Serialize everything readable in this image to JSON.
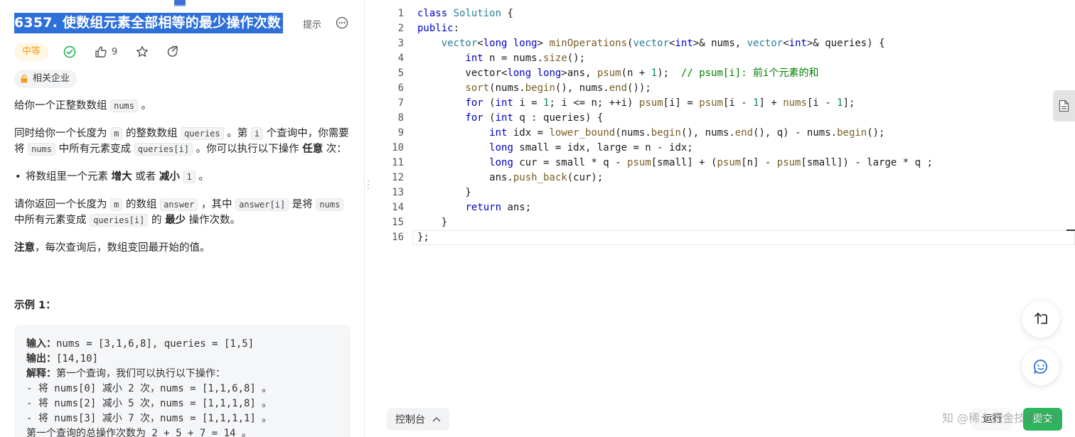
{
  "problem": {
    "title": "6357. 使数组元素全部相等的最少操作次数",
    "hint_label": "提示",
    "difficulty": "中等",
    "likes": "9",
    "company_tag": "相关企业"
  },
  "description": {
    "p1_a": "给你一个正整数数组 ",
    "p1_code": "nums",
    "p1_b": " 。",
    "p2_a": "同时给你一个长度为 ",
    "p2_code1": "m",
    "p2_b": " 的整数数组 ",
    "p2_code2": "queries",
    "p2_c": " 。第 ",
    "p2_code3": "i",
    "p2_d": " 个查询中，你需要将 ",
    "p2_code4": "nums",
    "p2_e": " 中所有元素变成 ",
    "p2_code5": "queries[i]",
    "p2_f": " 。你可以执行以下操作 ",
    "p2_bold": "任意",
    "p2_g": " 次：",
    "bullet_a": "将数组里一个元素 ",
    "bullet_bold1": "增大",
    "bullet_b": " 或者 ",
    "bullet_bold2": "减小",
    "bullet_c": " ",
    "bullet_code": "1",
    "bullet_d": " 。",
    "p3_a": "请你返回一个长度为 ",
    "p3_code1": "m",
    "p3_b": " 的数组 ",
    "p3_code2": "answer",
    "p3_c": " ，其中 ",
    "p3_code3": "answer[i]",
    "p3_d": " 是将 ",
    "p3_code4": "nums",
    "p3_e": " 中所有元素变成 ",
    "p3_code5": "queries[i]",
    "p3_f": " 的 ",
    "p3_bold": "最少",
    "p3_g": " 操作次数。",
    "note_bold": "注意",
    "note_text": "，每次查询后，数组变回最开始的值。"
  },
  "example": {
    "title": "示例 1：",
    "input_label": "输入：",
    "input_value": "nums = [3,1,6,8], queries = [1,5]",
    "output_label": "输出：",
    "output_value": "[14,10]",
    "explain_label": "解释：",
    "explain_value": "第一个查询，我们可以执行以下操作：",
    "line4": "- 将 nums[0] 减小 2 次，nums = [1,1,6,8] 。",
    "line5": "- 将 nums[2] 减小 5 次，nums = [1,1,1,8] 。",
    "line6": "- 将 nums[3] 减小 7 次，nums = [1,1,1,1] 。",
    "line7": "第一个查询的总操作次数为 2 + 5 + 7 = 14 。"
  },
  "editor": {
    "line_numbers": [
      "1",
      "2",
      "3",
      "4",
      "5",
      "6",
      "7",
      "8",
      "9",
      "10",
      "11",
      "12",
      "13",
      "14",
      "15",
      "16"
    ],
    "comment": "// psum[i]: 前i个元素的和"
  },
  "footer": {
    "console_label": "控制台",
    "watermark": "知 @稀土掘金技术社区",
    "run_label": "运行",
    "submit_label": "提交"
  },
  "colors": {
    "title_highlight": "#2f6fd8",
    "difficulty_text": "#f0a020",
    "accepted_icon": "#2db55d",
    "submit_bg": "#2db55d",
    "keyword": "#0000c8",
    "comment": "#008000"
  },
  "icons": [
    "book-icon",
    "more-icon",
    "check-circle-icon",
    "thumbs-up-icon",
    "star-icon",
    "share-icon",
    "lock-icon",
    "file-icon",
    "switch-icon",
    "chat-icon",
    "chevron-up-icon"
  ]
}
